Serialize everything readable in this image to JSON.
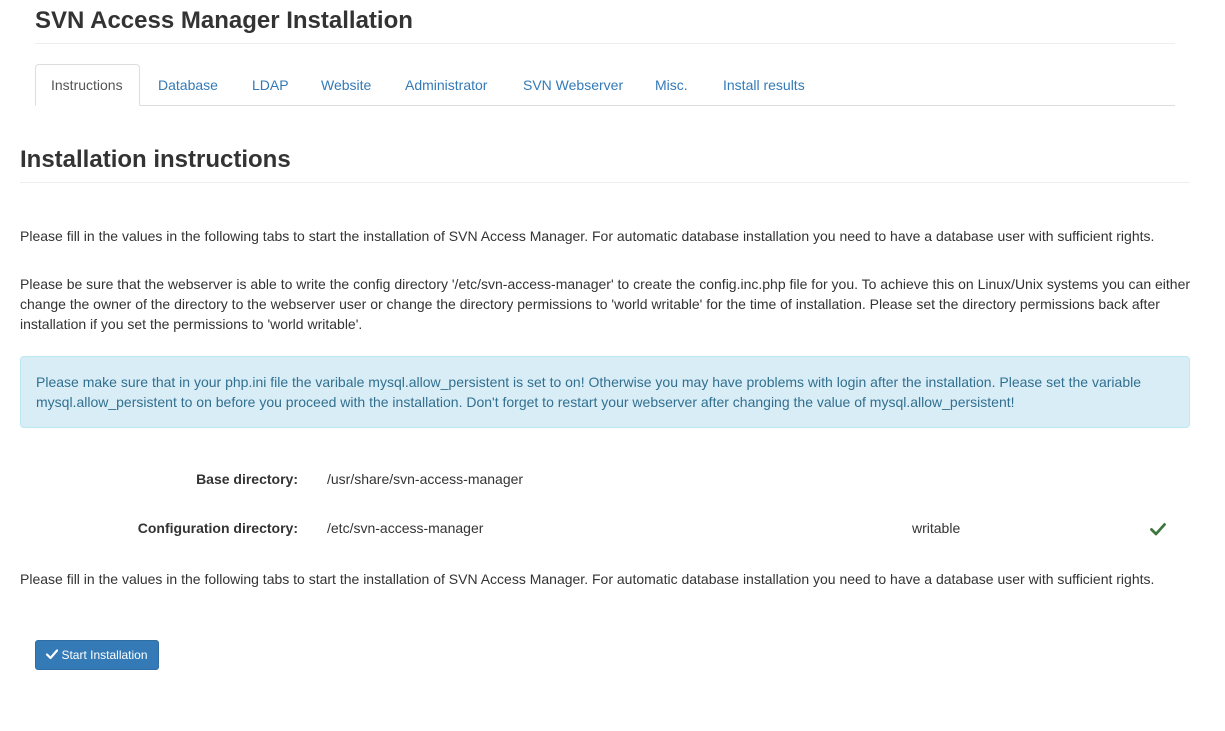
{
  "header": {
    "title": "SVN Access Manager Installation"
  },
  "tabs": [
    {
      "label": "Instructions",
      "active": true
    },
    {
      "label": "Database",
      "active": false
    },
    {
      "label": "LDAP",
      "active": false
    },
    {
      "label": "Website",
      "active": false
    },
    {
      "label": "Administrator",
      "active": false
    },
    {
      "label": "SVN Webserver",
      "active": false
    },
    {
      "label": "Misc.",
      "active": false
    },
    {
      "label": "Install results",
      "active": false
    }
  ],
  "main": {
    "title": "Installation instructions",
    "intro": "Please fill in the values in the following tabs to start the installation of SVN Access Manager. For automatic database installation you need to have a database user with sufficient rights.",
    "webserver_note": "Please be sure that the webserver is able to write the config directory '/etc/svn-access-manager' to create the config.inc.php file for you. To achieve this on Linux/Unix systems you can either change the owner of the directory to the webserver user or change the directory permissions to 'world writable' for the time of installation. Please set the directory permissions back after installation if you set the permissions to 'world writable'.",
    "alert": "Please make sure that in your php.ini file the varibale mysql.allow_persistent is set to on! Otherwise you may have problems with login after the installation. Please set the variable mysql.allow_persistent to on before you proceed with the installation. Don't forget to restart your webserver after changing the value of mysql.allow_persistent!",
    "base_dir": {
      "label": "Base directory:",
      "value": "/usr/share/svn-access-manager"
    },
    "config_dir": {
      "label": "Configuration directory:",
      "value": "/etc/svn-access-manager",
      "status": "writable",
      "status_icon": "check-icon"
    },
    "footer_note": "Please fill in the values in the following tabs to start the installation of SVN Access Manager. For automatic database installation you need to have a database user with sufficient rights.",
    "start_button": "Start Installation"
  },
  "colors": {
    "link": "#337ab7",
    "success": "#3c763d",
    "alert_bg": "#d9edf7",
    "alert_text": "#31708f",
    "button_bg": "#337ab7"
  }
}
